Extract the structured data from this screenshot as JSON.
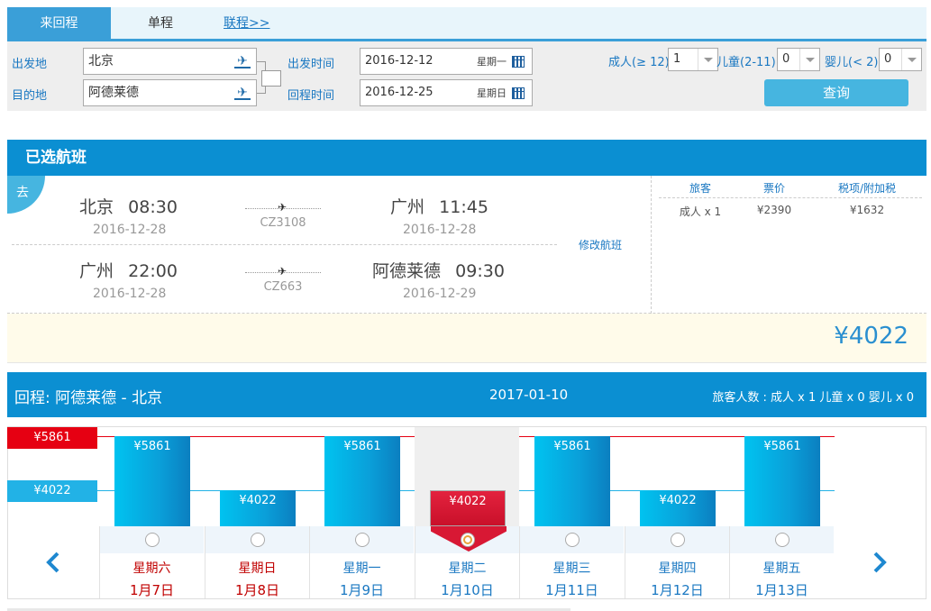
{
  "tabs": {
    "round_trip": "来回程",
    "one_way": "单程",
    "multi": "联程>>"
  },
  "search": {
    "from_label": "出发地",
    "from_value": "北京",
    "to_label": "目的地",
    "to_value": "阿德莱德",
    "depart_label": "出发时间",
    "depart_date": "2016-12-12",
    "depart_week": "星期一",
    "return_label": "回程时间",
    "return_date": "2016-12-25",
    "return_week": "星期日",
    "adult_label": "成人(≥ 12)",
    "adult_value": "1",
    "child_label": "儿童(2-11)",
    "child_value": "0",
    "infant_label": "婴儿(< 2)",
    "infant_value": "0",
    "query_button": "查询"
  },
  "selected": {
    "title": "已选航班",
    "direction_badge": "去",
    "flights": [
      {
        "dep_city": "北京",
        "dep_time": "08:30",
        "dep_date": "2016-12-28",
        "flight_no": "CZ3108",
        "arr_city": "广州",
        "arr_time": "11:45",
        "arr_date": "2016-12-28"
      },
      {
        "dep_city": "广州",
        "dep_time": "22:00",
        "dep_date": "2016-12-28",
        "flight_no": "CZ663",
        "arr_city": "阿德莱德",
        "arr_time": "09:30",
        "arr_date": "2016-12-29"
      }
    ],
    "modify_link": "修改航班",
    "price_headers": {
      "passenger": "旅客",
      "fare": "票价",
      "tax": "税项/附加税"
    },
    "price_row": {
      "passenger": "成人 x 1",
      "fare": "¥2390",
      "tax": "¥1632"
    },
    "total": "¥4022"
  },
  "return_panel": {
    "title": "回程:   阿德莱德 - 北京",
    "date": "2017-01-10",
    "passengers": "旅客人数 : 成人 x 1    儿童 x 0    婴儿 x 0"
  },
  "chart_data": {
    "type": "bar",
    "legend_high": "¥5861",
    "legend_low": "¥4022",
    "high_value": 5861,
    "low_value": 4022,
    "days": [
      {
        "weekday": "星期六",
        "date": "1月7日",
        "price": 5861,
        "label": "¥5861",
        "weekend": true,
        "selected": false
      },
      {
        "weekday": "星期日",
        "date": "1月8日",
        "price": 4022,
        "label": "¥4022",
        "weekend": true,
        "selected": false
      },
      {
        "weekday": "星期一",
        "date": "1月9日",
        "price": 5861,
        "label": "¥5861",
        "weekend": false,
        "selected": false
      },
      {
        "weekday": "星期二",
        "date": "1月10日",
        "price": 4022,
        "label": "¥4022",
        "weekend": false,
        "selected": true
      },
      {
        "weekday": "星期三",
        "date": "1月11日",
        "price": 5861,
        "label": "¥5861",
        "weekend": false,
        "selected": false
      },
      {
        "weekday": "星期四",
        "date": "1月12日",
        "price": 4022,
        "label": "¥4022",
        "weekend": false,
        "selected": false
      },
      {
        "weekday": "星期五",
        "date": "1月13日",
        "price": 5861,
        "label": "¥5861",
        "weekend": false,
        "selected": false
      }
    ]
  },
  "colors": {
    "primary": "#0b8fd2",
    "accent_light": "#46b5e0",
    "high_price": "#e60012",
    "low_price": "#22b2e6",
    "weekend_text": "#c00000",
    "link": "#1a78c2"
  }
}
